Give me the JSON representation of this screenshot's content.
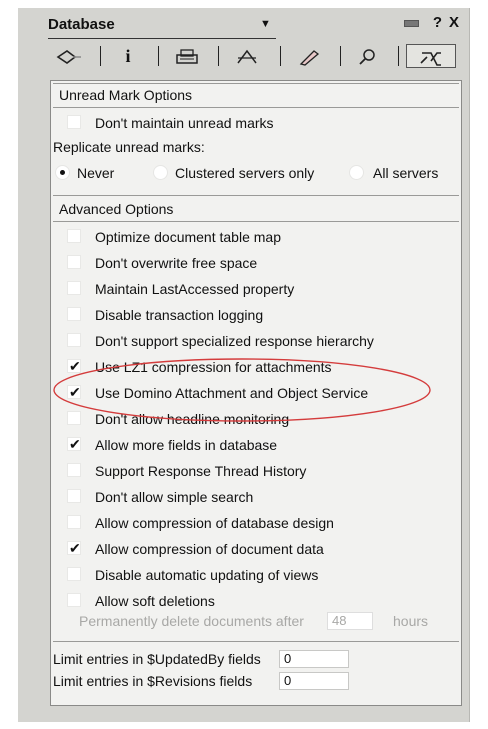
{
  "header": {
    "title": "Database",
    "dropdown_glyph": "▼",
    "help_label": "?",
    "close_label": "X"
  },
  "tabs": [
    {
      "icon": "info-bubble-icon"
    },
    {
      "icon": "info-icon"
    },
    {
      "icon": "printer-icon"
    },
    {
      "icon": "design-icon"
    },
    {
      "icon": "launch-icon"
    },
    {
      "icon": "search-icon"
    },
    {
      "icon": "advanced-icon"
    }
  ],
  "unread": {
    "section_title": "Unread Mark Options",
    "dont_maintain": "Don't maintain unread marks",
    "replicate_label": "Replicate unread marks:",
    "options": [
      "Never",
      "Clustered servers only",
      "All servers"
    ],
    "selected": "Never"
  },
  "advanced": {
    "section_title": "Advanced Options",
    "items": [
      {
        "label": "Optimize document table map",
        "checked": false
      },
      {
        "label": "Don't overwrite free space",
        "checked": false
      },
      {
        "label": "Maintain LastAccessed property",
        "checked": false
      },
      {
        "label": "Disable transaction logging",
        "checked": false
      },
      {
        "label": "Don't support specialized response hierarchy",
        "checked": false
      },
      {
        "label": "Use LZ1 compression for attachments",
        "checked": true
      },
      {
        "label": "Use Domino Attachment and Object Service",
        "checked": true
      },
      {
        "label": "Don't allow headline monitoring",
        "checked": false
      },
      {
        "label": "Allow more fields in database",
        "checked": true
      },
      {
        "label": "Support Response Thread History",
        "checked": false
      },
      {
        "label": "Don't allow simple search",
        "checked": false
      },
      {
        "label": "Allow compression of database design",
        "checked": false
      },
      {
        "label": "Allow compression of document data",
        "checked": true
      },
      {
        "label": "Disable automatic updating of views",
        "checked": false
      },
      {
        "label": "Allow soft deletions",
        "checked": false
      }
    ],
    "soft_delete_prefix": "Permanently delete documents after",
    "soft_delete_value": "48",
    "soft_delete_suffix": "hours"
  },
  "limits": {
    "updatedby_label": "Limit entries in $UpdatedBy fields",
    "updatedby_value": "0",
    "revisions_label": "Limit entries in $Revisions fields",
    "revisions_value": "0"
  },
  "colors": {
    "panel_bg": "#d4d4d0",
    "content_bg": "#f2f2f0",
    "highlight_ellipse": "#d43c3c",
    "disabled_text": "#a8a8a6"
  }
}
